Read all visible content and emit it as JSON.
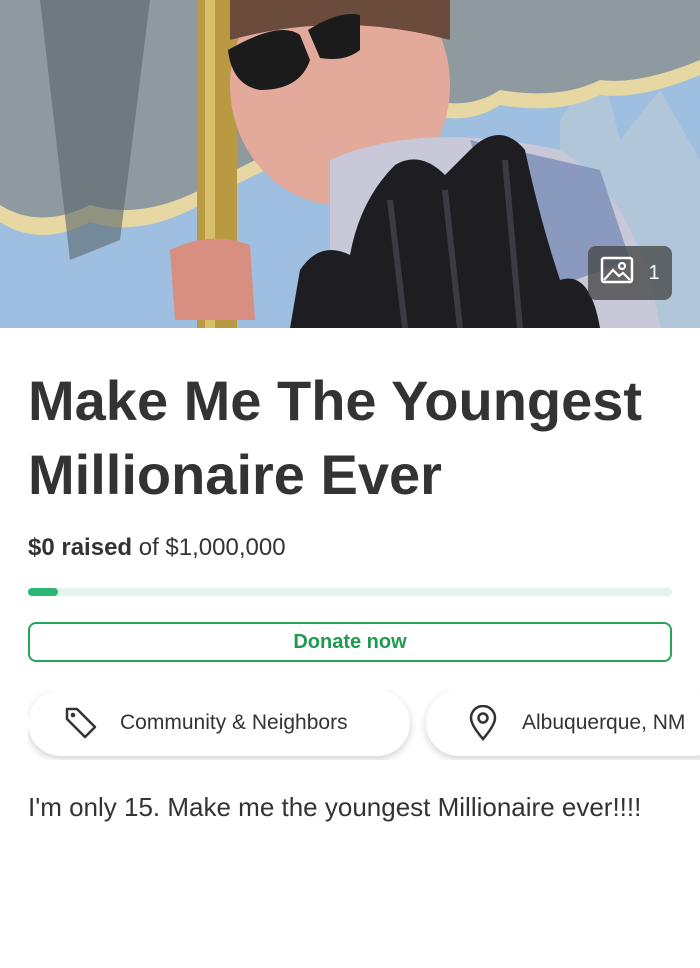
{
  "hero": {
    "image_alt": "Photo of a teenager in sunglasses under a striped umbrella",
    "photo_count": "1"
  },
  "campaign": {
    "title": "Make Me The Youngest Millionaire Ever",
    "raised_amount": "$0 raised",
    "goal_text": "of $1,000,000",
    "progress_fraction": 0.0,
    "donate_label": "Donate now",
    "category": "Community & Neighbors",
    "location": "Albuquerque, NM",
    "description": "I'm only 15. Make me the youngest Millionaire ever!!!!"
  },
  "colors": {
    "accent": "#25a55c",
    "progress_track": "#e3f4ea"
  },
  "icons": {
    "photo": "image-icon",
    "category": "tag-icon",
    "location": "map-pin-icon"
  }
}
